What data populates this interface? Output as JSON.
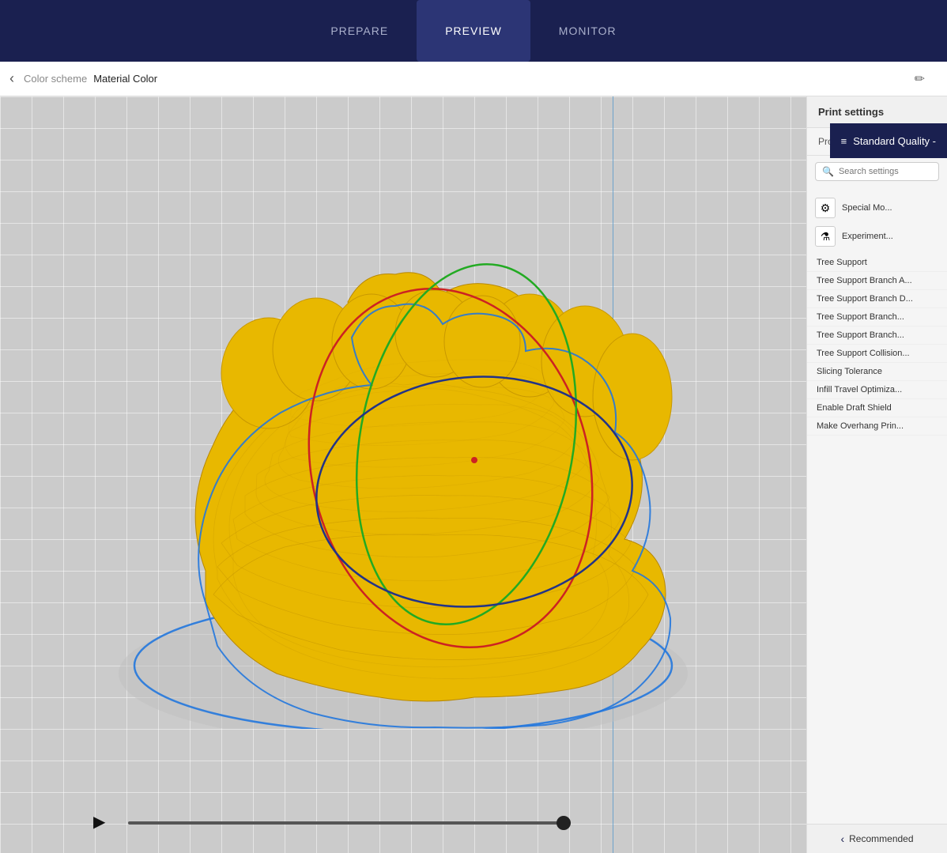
{
  "nav": {
    "tabs": [
      {
        "label": "PREPARE",
        "active": false
      },
      {
        "label": "PREVIEW",
        "active": true
      },
      {
        "label": "MONITOR",
        "active": false
      }
    ]
  },
  "toolbar": {
    "back_label": "‹",
    "color_scheme_label": "Color scheme",
    "color_scheme_value": "Material Color",
    "edit_icon": "✏",
    "quality_label": "Standard Quality -"
  },
  "settings_panel": {
    "header": "Print settings",
    "profile_label": "Profile",
    "profile_value": "Stan",
    "search_placeholder": "Search settings",
    "icons": [
      {
        "icon": "⚙",
        "label": "Special Mo..."
      },
      {
        "icon": "⚗",
        "label": "Experiment..."
      }
    ],
    "items": [
      "Tree Support",
      "Tree Support Branch A...",
      "Tree Support Branch D...",
      "Tree Support Branch...",
      "Tree Support Branch...",
      "Tree Support Collision...",
      "Slicing Tolerance",
      "Infill Travel Optimiza...",
      "Enable Draft Shield",
      "Make Overhang Prin..."
    ],
    "recommended_label": "Recommended"
  },
  "playback": {
    "play_icon": "▶",
    "slider_progress": 95
  },
  "viewport": {
    "vertical_line": true
  }
}
